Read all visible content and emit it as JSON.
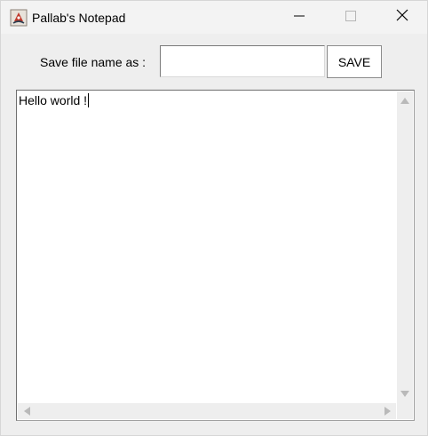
{
  "window": {
    "title": "Pallab's Notepad",
    "app_icon": "java-cup-icon",
    "controls": {
      "minimize_icon": "minimize-icon",
      "maximize_icon": "maximize-icon",
      "close_icon": "close-icon"
    }
  },
  "toolbar": {
    "filename_label": "Save file name as :",
    "filename_value": "",
    "filename_placeholder": "",
    "save_label": "SAVE"
  },
  "editor": {
    "content": "Hello world !"
  },
  "colors": {
    "window_bg": "#eeeeee",
    "titlebar_bg": "#f3f3f3",
    "editor_bg": "#ffffff",
    "scroll_arrow": "#b9b9b9"
  }
}
